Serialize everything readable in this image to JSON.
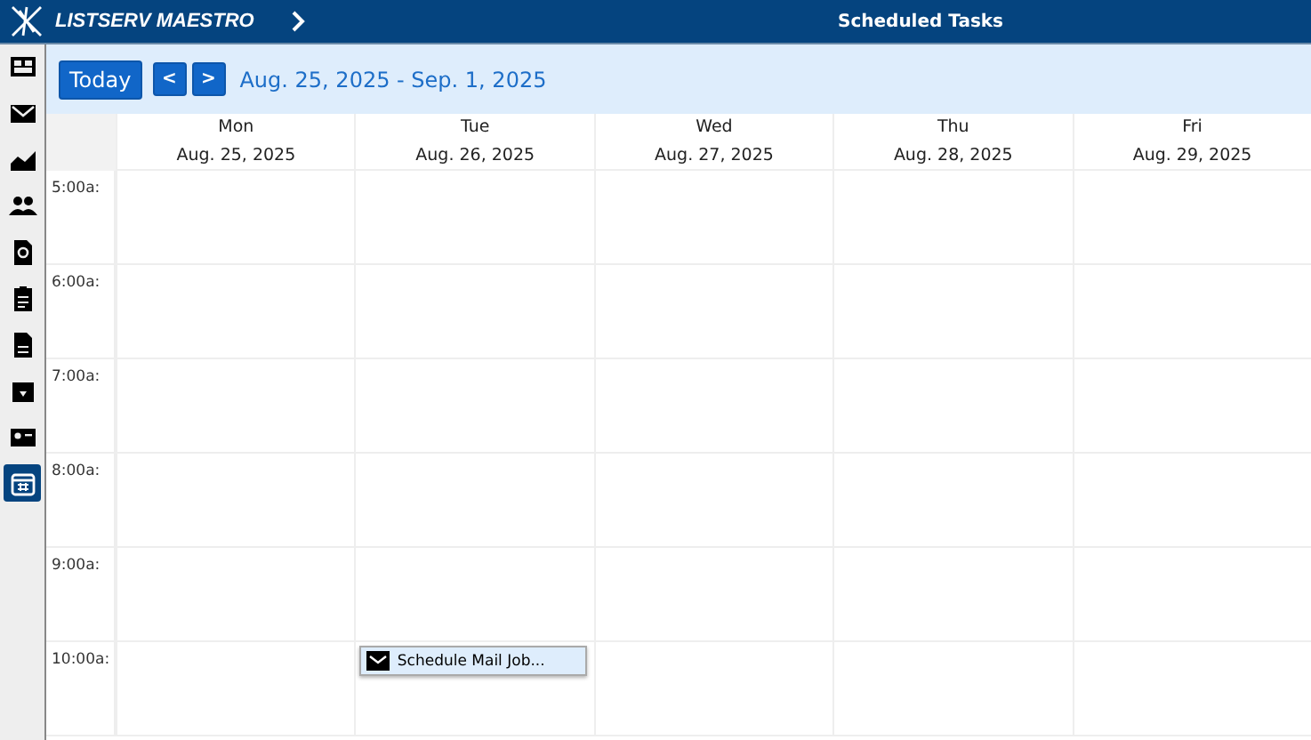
{
  "header": {
    "app_name": "LISTSERV MAESTRO",
    "page_title": "Scheduled Tasks"
  },
  "sidebar": {
    "items": [
      {
        "selected": false
      },
      {
        "selected": false
      },
      {
        "selected": false
      },
      {
        "selected": false
      },
      {
        "selected": false
      },
      {
        "selected": false
      },
      {
        "selected": false
      },
      {
        "selected": false
      },
      {
        "selected": false
      },
      {
        "selected": true
      }
    ]
  },
  "toolbar": {
    "today": "Today",
    "prev": "<",
    "next": ">",
    "range": "Aug. 25, 2025 - Sep. 1, 2025"
  },
  "calendar": {
    "days": [
      {
        "weekday": "Mon",
        "date": "Aug. 25, 2025"
      },
      {
        "weekday": "Tue",
        "date": "Aug. 26, 2025"
      },
      {
        "weekday": "Wed",
        "date": "Aug. 27, 2025"
      },
      {
        "weekday": "Thu",
        "date": "Aug. 28, 2025"
      },
      {
        "weekday": "Fri",
        "date": "Aug. 29, 2025"
      }
    ],
    "rows": [
      {
        "time": "5:00a:"
      },
      {
        "time": "6:00a:"
      },
      {
        "time": "7:00a:"
      },
      {
        "time": "8:00a:"
      },
      {
        "time": "9:00a:"
      },
      {
        "time": "10:00a:",
        "cells": [
          null,
          {
            "event": "Schedule Mail Job..."
          },
          null,
          null,
          null
        ]
      }
    ]
  }
}
